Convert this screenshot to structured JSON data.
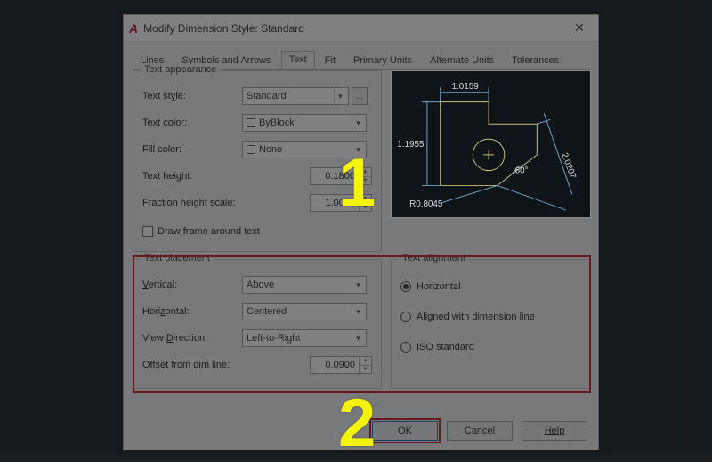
{
  "window": {
    "title": "Modify Dimension Style: Standard"
  },
  "tabs": {
    "lines": "Lines",
    "symbols": "Symbols and Arrows",
    "text": "Text",
    "fit": "Fit",
    "primary": "Primary Units",
    "alternate": "Alternate Units",
    "tolerances": "Tolerances"
  },
  "appearance": {
    "group_label": "Text appearance",
    "style_label": "Text style:",
    "style_value": "Standard",
    "color_label": "Text color:",
    "color_value": "ByBlock",
    "fill_label": "Fill color:",
    "fill_value": "None",
    "height_label": "Text height:",
    "height_value": "0.1800",
    "frac_label": "Fraction height scale:",
    "frac_value": "1.0000",
    "frame_label": "Draw frame around text"
  },
  "placement": {
    "group_label": "Text placement",
    "vertical_label": "Vertical:",
    "vertical_value": "Above",
    "horizontal_label": "Horizontal:",
    "horizontal_value": "Centered",
    "viewdir_label": "View Direction:",
    "viewdir_value": "Left-to-Right",
    "offset_label": "Offset from dim line:",
    "offset_value": "0.0900"
  },
  "alignment": {
    "group_label": "Text alignment",
    "horizontal": "Horizontal",
    "aligned": "Aligned with dimension line",
    "iso": "ISO standard",
    "selected": "horizontal"
  },
  "preview": {
    "dim_top": "1.0159",
    "dim_left": "1.1955",
    "dim_right": "2.0207",
    "dim_angle": "60°",
    "dim_radius": "R0.8045"
  },
  "buttons": {
    "ok": "OK",
    "cancel": "Cancel",
    "help": "Help"
  },
  "annotations": {
    "num1": "1",
    "num2": "2"
  }
}
